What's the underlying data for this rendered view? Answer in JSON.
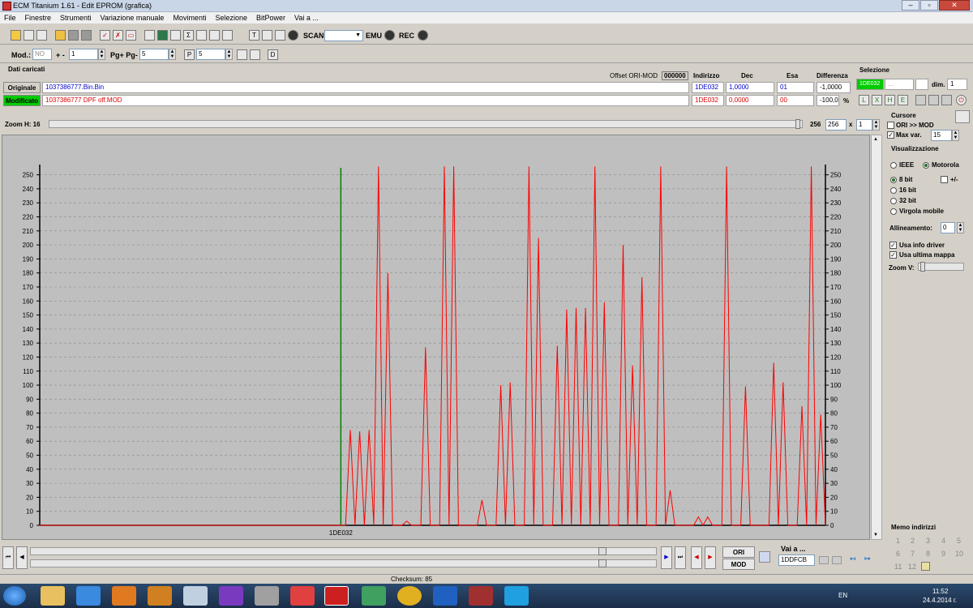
{
  "window": {
    "title": "ECM Titanium 1.61 - Edit EPROM (grafica)",
    "btn_min": "–",
    "btn_max": "▫",
    "btn_close": "✕"
  },
  "menu": [
    "File",
    "Finestre",
    "Strumenti",
    "Variazione manuale",
    "Movimenti",
    "Selezione",
    "BitPower",
    "Vai a ..."
  ],
  "toolbar1": {
    "scan_label": "SCAN",
    "emu_label": "EMU",
    "rec_label": "REC"
  },
  "toolbar2": {
    "mod_label": "Mod.:",
    "mod_value": "NO",
    "plusminus_label": "+ -",
    "plusminus_value": "1",
    "pg_label": "Pg+ Pg-",
    "pg_value": "5",
    "p_value": "5"
  },
  "data_panel": {
    "title": "Dati caricati",
    "offset_label": "Offset ORI-MOD",
    "offset_value": "000000",
    "col_indirizzo": "Indirizzo",
    "col_dec": "Dec",
    "col_esa": "Esa",
    "col_differenza": "Differenza",
    "selezione_label": "Selezione",
    "original_label": "Originale",
    "original_file": "1037386777.Bin.Bin",
    "original_addr": "1DE032",
    "original_dec": "1,0000",
    "original_esa": "01",
    "original_diff": "-1,0000",
    "modified_label": "Modificato",
    "modified_file": "1037386777 DPF off.MOD",
    "modified_addr": "1DE032",
    "modified_dec": "0,0000",
    "modified_esa": "00",
    "modified_diff": "-100,0",
    "pct": "%",
    "sel_addr": "1DE032",
    "sel_dots": "...",
    "dim_label": "dim.",
    "dim_value": "1"
  },
  "zoom": {
    "label": "Zoom H: 16",
    "value1": "256",
    "value2": "256",
    "times": "x",
    "value3": "1"
  },
  "side": {
    "cursore": "Cursore",
    "ori_mod": "ORI >> MOD",
    "max_var": "Max var.",
    "max_var_value": "15",
    "visualizzazione": "Visualizzazione",
    "ieee": "IEEE",
    "motorola": "Motorola",
    "bit8": "8 bit",
    "plusminus": "+/-",
    "bit16": "16 bit",
    "bit32": "32 bit",
    "virgola": "Virgola mobile",
    "allineamento": "Allineamento:",
    "allineamento_value": "0",
    "usa_info": "Usa info driver",
    "usa_ultima": "Usa ultima mappa",
    "zoom_v": "Zoom V:",
    "memo": "Memo indirizzi",
    "memo_nums": [
      "1",
      "2",
      "3",
      "4",
      "5",
      "6",
      "7",
      "8",
      "9",
      "10",
      "11",
      "12"
    ]
  },
  "bottom": {
    "ori_label": "ORI",
    "mod_label": "MOD",
    "vai_label": "Vai a ...",
    "vai_value": "1DDFCB",
    "checksum": "Checksum: 85"
  },
  "taskbar": {
    "lang": "EN",
    "time": "11:52",
    "date": "24.4.2014 г."
  },
  "colors": {
    "series": "#ff0000",
    "cursor": "#008000",
    "chart_bg": "#bfbfbf",
    "green_badge": "#00cc00"
  },
  "chart_data": {
    "type": "line",
    "ylim": [
      0,
      255
    ],
    "y_ticks": [
      0,
      10,
      20,
      30,
      40,
      50,
      60,
      70,
      80,
      90,
      100,
      110,
      120,
      130,
      140,
      150,
      160,
      170,
      180,
      190,
      200,
      210,
      220,
      230,
      240,
      250
    ],
    "cursor_label": "1DE032",
    "cursor_index": 64,
    "series": [
      {
        "values": [
          0,
          0,
          0,
          0,
          0,
          0,
          0,
          0,
          0,
          0,
          0,
          0,
          0,
          0,
          0,
          0,
          0,
          0,
          0,
          0,
          0,
          0,
          0,
          0,
          0,
          0,
          0,
          0,
          0,
          0,
          0,
          0,
          0,
          0,
          0,
          0,
          0,
          0,
          0,
          0,
          0,
          0,
          0,
          0,
          0,
          0,
          0,
          0,
          0,
          0,
          0,
          0,
          0,
          0,
          0,
          0,
          0,
          0,
          0,
          0,
          0,
          0,
          0,
          0,
          0,
          0,
          68,
          0,
          67,
          0,
          68,
          0,
          256,
          0,
          180,
          0,
          0,
          0,
          3,
          0,
          0,
          0,
          127,
          0,
          0,
          0,
          256,
          0,
          256,
          0,
          0,
          0,
          0,
          0,
          18,
          0,
          0,
          0,
          100,
          0,
          102,
          0,
          0,
          0,
          256,
          0,
          205,
          0,
          0,
          0,
          128,
          0,
          154,
          0,
          155,
          0,
          155,
          0,
          256,
          0,
          159,
          0,
          0,
          0,
          200,
          0,
          114,
          0,
          177,
          0,
          0,
          0,
          256,
          0,
          25,
          0,
          0,
          0,
          0,
          0,
          6,
          0,
          6,
          0,
          0,
          0,
          256,
          0,
          0,
          0,
          99,
          0,
          0,
          0,
          0,
          0,
          116,
          0,
          102,
          0,
          0,
          0,
          85,
          0,
          256,
          0,
          79,
          0
        ]
      }
    ]
  }
}
